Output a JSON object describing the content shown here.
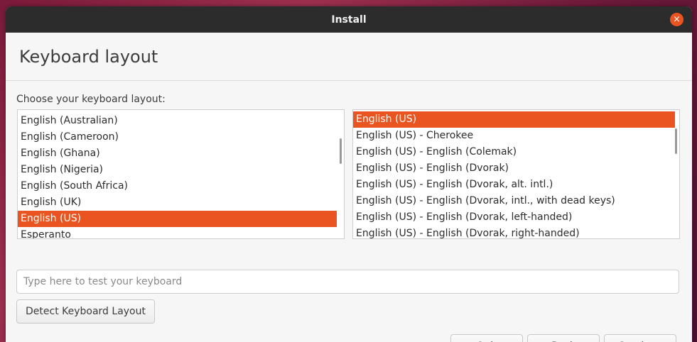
{
  "window": {
    "title": "Install"
  },
  "header": {
    "title": "Keyboard layout"
  },
  "prompt": "Choose your keyboard layout:",
  "left_list": {
    "items": [
      {
        "label": "English (Australian)"
      },
      {
        "label": "English (Cameroon)"
      },
      {
        "label": "English (Ghana)"
      },
      {
        "label": "English (Nigeria)"
      },
      {
        "label": "English (South Africa)"
      },
      {
        "label": "English (UK)"
      },
      {
        "label": "English (US)",
        "selected": true
      },
      {
        "label": "Esperanto"
      }
    ]
  },
  "right_list": {
    "items": [
      {
        "label": "English (US)",
        "selected": true
      },
      {
        "label": "English (US) - Cherokee"
      },
      {
        "label": "English (US) - English (Colemak)"
      },
      {
        "label": "English (US) - English (Dvorak)"
      },
      {
        "label": "English (US) - English (Dvorak, alt. intl.)"
      },
      {
        "label": "English (US) - English (Dvorak, intl., with dead keys)"
      },
      {
        "label": "English (US) - English (Dvorak, left-handed)"
      },
      {
        "label": "English (US) - English (Dvorak, right-handed)"
      }
    ]
  },
  "test_input": {
    "placeholder": "Type here to test your keyboard",
    "value": ""
  },
  "buttons": {
    "detect": "Detect Keyboard Layout",
    "quit": "Quit",
    "back": "Back",
    "continue": "Continue"
  },
  "colors": {
    "accent": "#e95420",
    "titlebar": "#2c2c2c",
    "background": "#f6f6f6"
  },
  "icons": {
    "close": "close-icon"
  }
}
